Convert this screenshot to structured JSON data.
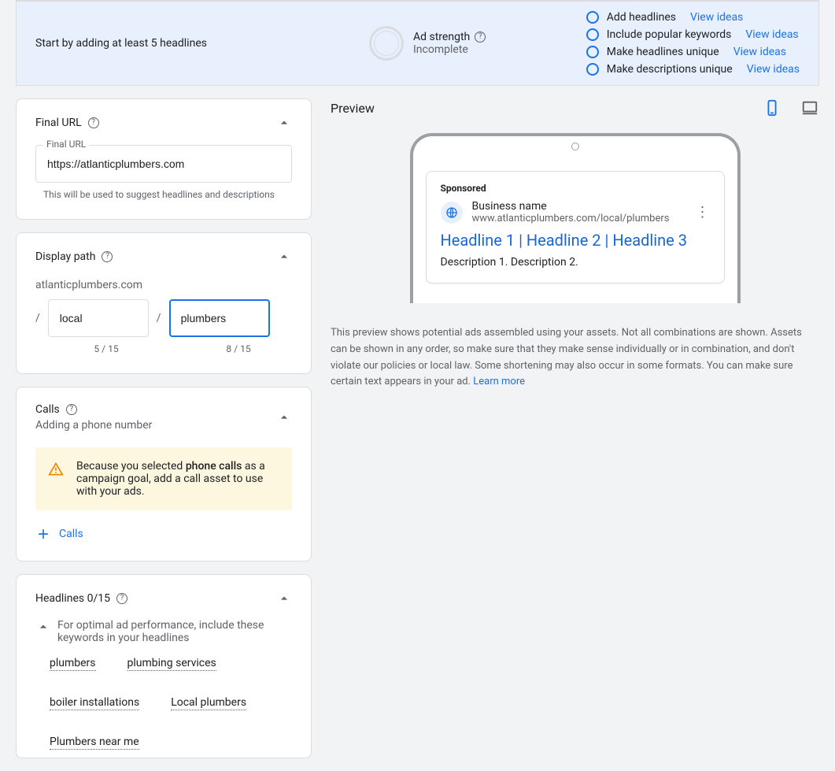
{
  "banner": {
    "intro": "Start by adding at least 5 headlines",
    "strength_label": "Ad strength",
    "strength_status": "Incomplete",
    "hints": [
      {
        "label": "Add headlines",
        "link": "View ideas"
      },
      {
        "label": "Include popular keywords",
        "link": "View ideas"
      },
      {
        "label": "Make headlines unique",
        "link": "View ideas"
      },
      {
        "label": "Make descriptions unique",
        "link": "View ideas"
      }
    ]
  },
  "final_url": {
    "section": "Final URL",
    "label": "Final URL",
    "value": "https://atlanticplumbers.com",
    "helper": "This will be used to suggest headlines and descriptions"
  },
  "display_path": {
    "section": "Display path",
    "domain": "atlanticplumbers.com",
    "p1": "local",
    "p1_counter": "5 / 15",
    "p2": "plumbers",
    "p2_counter": "8 / 15"
  },
  "calls": {
    "section": "Calls",
    "subtitle": "Adding a phone number",
    "warn_pre": "Because you selected ",
    "warn_bold": "phone calls",
    "warn_post": " as a campaign goal, add a call asset to use with your ads.",
    "add_label": "Calls"
  },
  "headlines": {
    "section": "Headlines 0/15",
    "tip": "For optimal ad performance, include these keywords in your headlines",
    "keywords": [
      "plumbers",
      "plumbing services",
      "boiler installations",
      "Local plumbers",
      "Plumbers near me"
    ]
  },
  "preview": {
    "title": "Preview",
    "sponsored": "Sponsored",
    "business": "Business name",
    "url": "www.atlanticplumbers.com/local/plumbers",
    "headline": "Headline 1 | Headline 2 | Headline 3",
    "description": "Description 1. Description 2.",
    "disclaimer": "This preview shows potential ads assembled using your assets. Not all combinations are shown. Assets can be shown in any order, so make sure that they make sense individually or in combination, and don't violate our policies or local law. Some shortening may also occur in some formats. You can make sure certain text appears in your ad. ",
    "learn_more": "Learn more"
  }
}
